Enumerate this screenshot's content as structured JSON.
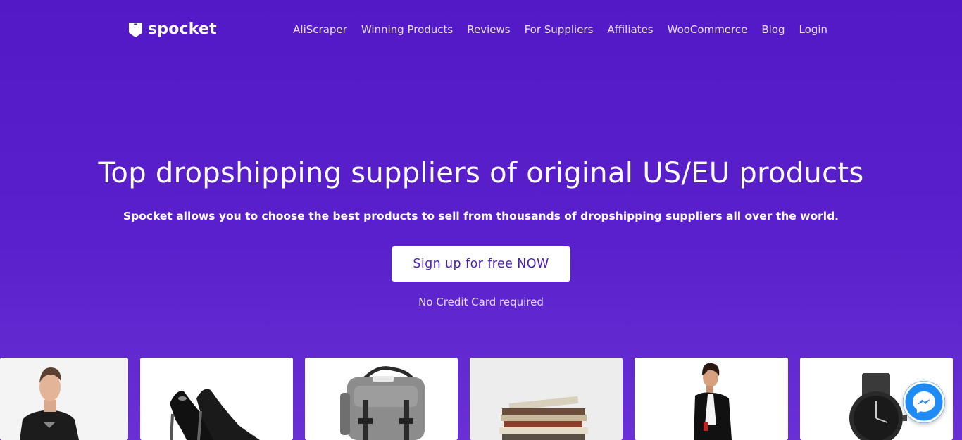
{
  "brand": {
    "name": "spocket"
  },
  "nav": {
    "items": [
      {
        "label": "AliScraper"
      },
      {
        "label": "Winning Products"
      },
      {
        "label": "Reviews"
      },
      {
        "label": "For Suppliers"
      },
      {
        "label": "Affiliates"
      },
      {
        "label": "WooCommerce"
      },
      {
        "label": "Blog"
      },
      {
        "label": "Login"
      }
    ]
  },
  "hero": {
    "title": "Top dropshipping suppliers of original US/EU products",
    "subtitle": "Spocket allows you to choose the best products to sell from thousands of dropshipping suppliers all over the world.",
    "cta_label": "Sign up for free NOW",
    "note": "No Credit Card required"
  },
  "products": [
    {
      "icon": "man-tshirt-photo"
    },
    {
      "icon": "black-heels-photo"
    },
    {
      "icon": "backpack-photo"
    },
    {
      "icon": "book-stack-photo"
    },
    {
      "icon": "woman-fashion-photo"
    },
    {
      "icon": "watch-photo"
    }
  ],
  "chat": {
    "icon": "messenger-icon"
  },
  "colors": {
    "background": "#5319c7",
    "cta_text": "#4a1eb8",
    "messenger": "#1f8cf5"
  }
}
